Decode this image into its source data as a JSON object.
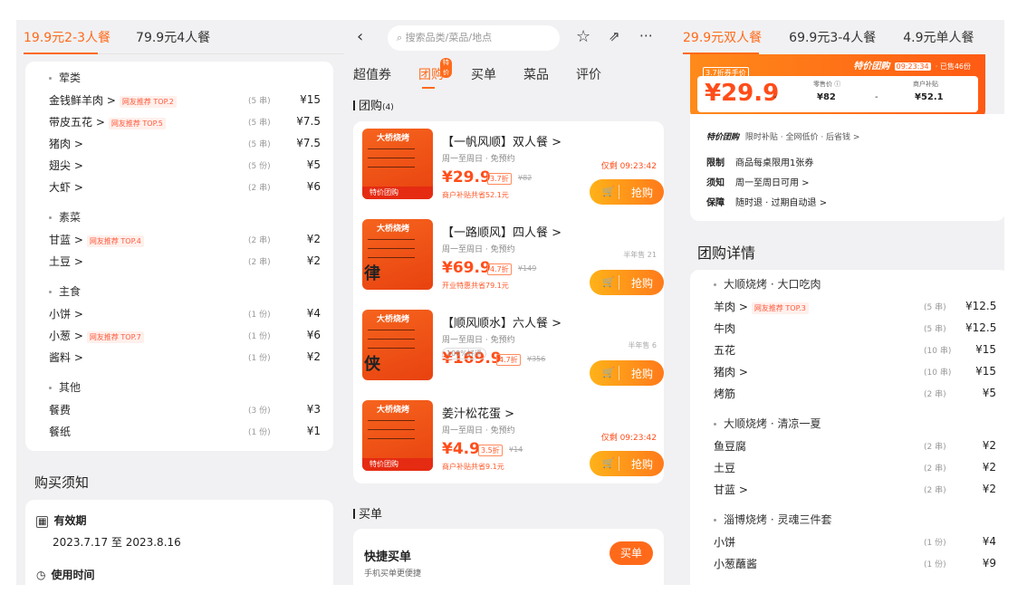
{
  "left": {
    "tabs": [
      "19.9元2-3人餐",
      "79.9元4人餐"
    ],
    "groups": [
      {
        "name": "荤类",
        "items": [
          {
            "name": "金钱鲜羊肉 >",
            "tag": "网友推荐 TOP.2",
            "qty": "(5 串)",
            "price": "¥15"
          },
          {
            "name": "带皮五花 >",
            "tag": "网友推荐 TOP.5",
            "qty": "(5 串)",
            "price": "¥7.5"
          },
          {
            "name": "猪肉 >",
            "tag": "",
            "qty": "(5 串)",
            "price": "¥7.5"
          },
          {
            "name": "翅尖 >",
            "tag": "",
            "qty": "(5 份)",
            "price": "¥5"
          },
          {
            "name": "大虾 >",
            "tag": "",
            "qty": "(2 串)",
            "price": "¥6"
          }
        ]
      },
      {
        "name": "素菜",
        "items": [
          {
            "name": "甘蓝 >",
            "tag": "网友推荐 TOP.4",
            "qty": "(2 串)",
            "price": "¥2"
          },
          {
            "name": "土豆 >",
            "tag": "",
            "qty": "(2 串)",
            "price": "¥2"
          }
        ]
      },
      {
        "name": "主食",
        "items": [
          {
            "name": "小饼 >",
            "tag": "",
            "qty": "(1 份)",
            "price": "¥4"
          },
          {
            "name": "小葱 >",
            "tag": "网友推荐 TOP.7",
            "qty": "(1 份)",
            "price": "¥6"
          },
          {
            "name": "酱料 >",
            "tag": "",
            "qty": "(1 份)",
            "price": "¥2"
          }
        ]
      },
      {
        "name": "其他",
        "items": [
          {
            "name": "餐费",
            "tag": "",
            "qty": "(3 份)",
            "price": "¥3"
          },
          {
            "name": "餐纸",
            "tag": "",
            "qty": "(1 份)",
            "price": "¥1"
          }
        ]
      }
    ],
    "notice_title": "购买须知",
    "validity_label": "有效期",
    "validity_value": "2023.7.17 至 2023.8.16",
    "usetime_label": "使用时间"
  },
  "middle": {
    "search_placeholder": "搜索品类/菜品/地点",
    "tabs": [
      "超值券",
      "团购",
      "买单",
      "菜品",
      "评价"
    ],
    "tab_badge": "特价",
    "group_title": "团购",
    "group_count": "(4)",
    "deals": [
      {
        "title": "【一帆风顺】双人餐 >",
        "sub": "周一至周日 · 免预约",
        "price": "¥29.9",
        "disc": "3.7折",
        "orig": "¥82",
        "note": "商户补贴共省52.1元",
        "status": "仅剩 09:23:42",
        "btn": "抢购",
        "badge": "特价团购",
        "sign": ""
      },
      {
        "title": "【一路顺风】四人餐 >",
        "sub": "周一至周日 · 免预约",
        "price": "¥69.9",
        "disc": "4.7折",
        "orig": "¥149",
        "note": "开业特惠共省79.1元",
        "status": "半年售 21",
        "btn": "抢购",
        "badge": "",
        "sign": "律"
      },
      {
        "title": "【顺风顺水】六人餐 >",
        "sub": "周一至周日 · 免预约",
        "price": "¥169.9",
        "disc": "4.7折",
        "orig": "¥356",
        "note": "100%好评",
        "status": "半年售 6",
        "btn": "抢购",
        "badge": "",
        "sign": "侠"
      },
      {
        "title": "姜汁松花蛋 >",
        "sub": "周一至周日 · 免预约",
        "price": "¥4.9",
        "disc": "3.5折",
        "orig": "¥14",
        "note": "商户补贴共省9.1元",
        "status": "仅剩 09:23:42",
        "btn": "抢购",
        "badge": "特价团购",
        "sign": ""
      }
    ],
    "thumb_text": "大桥烧烤",
    "maidan_title": "买单",
    "quick_title": "快捷买单",
    "quick_sub": "手机买单更便捷",
    "quick_btn": "买单"
  },
  "right": {
    "tabs": [
      "29.9元双人餐",
      "69.9元3-4人餐",
      "4.9元单人餐"
    ],
    "promo_label": "3.7折券手价",
    "promo_brand": "特价团购",
    "promo_time": "09:23:34",
    "promo_sold": "· 已售46份",
    "promo_price": "¥29.9",
    "promo_orig_label": "零售价 ⓘ",
    "promo_orig": "¥82",
    "promo_sub_label": "商户补贴",
    "promo_sub": "¥52.1",
    "info_brand": "特价团购",
    "info_text": "限时补贴 · 全网低价 · 后省钱 >",
    "rules": [
      {
        "k": "限制",
        "v": "商品每桌限用1张券"
      },
      {
        "k": "须知",
        "v": "周一至周日可用 >"
      },
      {
        "k": "保障",
        "v": "随时退 · 过期自动退 >"
      }
    ],
    "detail_title": "团购详情",
    "groups": [
      {
        "name": "大顺烧烤 · 大口吃肉",
        "items": [
          {
            "name": "羊肉 >",
            "tag": "网友推荐 TOP.3",
            "qty": "(5 串)",
            "price": "¥12.5"
          },
          {
            "name": "牛肉",
            "tag": "",
            "qty": "(5 串)",
            "price": "¥12.5"
          },
          {
            "name": "五花",
            "tag": "",
            "qty": "(10 串)",
            "price": "¥15"
          },
          {
            "name": "猪肉 >",
            "tag": "",
            "qty": "(10 串)",
            "price": "¥15"
          },
          {
            "name": "烤筋",
            "tag": "",
            "qty": "(2 串)",
            "price": "¥5"
          }
        ]
      },
      {
        "name": "大顺烧烤 · 清凉一夏",
        "items": [
          {
            "name": "鱼豆腐",
            "tag": "",
            "qty": "(2 串)",
            "price": "¥2"
          },
          {
            "name": "土豆",
            "tag": "",
            "qty": "(2 串)",
            "price": "¥2"
          },
          {
            "name": "甘蓝 >",
            "tag": "",
            "qty": "(2 串)",
            "price": "¥2"
          }
        ]
      },
      {
        "name": "淄博烧烤 · 灵魂三件套",
        "items": [
          {
            "name": "小饼",
            "tag": "",
            "qty": "(1 份)",
            "price": "¥4"
          },
          {
            "name": "小葱蘸酱",
            "tag": "",
            "qty": "(1 份)",
            "price": "¥9"
          }
        ]
      }
    ]
  },
  "colors": {
    "accent": "#ff6a1a",
    "price": "#ff4d1a",
    "bg": "#f1f1f3"
  }
}
